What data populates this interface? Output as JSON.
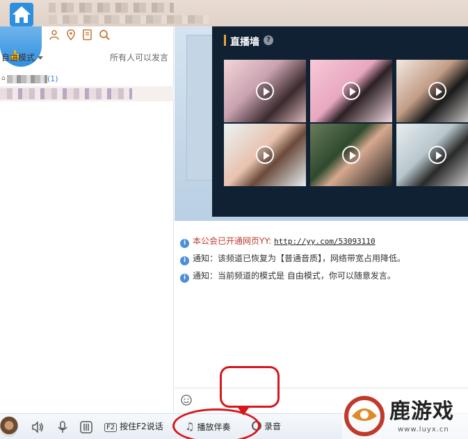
{
  "header": {
    "channel_title": ""
  },
  "left": {
    "mode_label": "自由模式",
    "speak_label": "所有人可以发言",
    "channel_count": "(1)"
  },
  "live_wall": {
    "title": "直播墙",
    "help": "?"
  },
  "chat": {
    "messages": [
      {
        "text": "本公会已开通网页YY:",
        "link": "http://yy.com/53093110"
      },
      {
        "text": "通知：该频道已恢复为【普通音质】，网络带宽占用降低。"
      },
      {
        "text": "通知：当前频道的模式是 自由模式，你可以随意发言。"
      }
    ]
  },
  "toolbar": {
    "f2_key": "F2",
    "push_to_talk": "按住F2说话",
    "play_accompaniment": "播放伴奏",
    "record": "录音"
  },
  "watermark": {
    "text": "鹿游戏",
    "url": "www.luyx.cn"
  },
  "colors": {
    "accent_blue": "#2f8fdf",
    "wall_bg": "#0f2133",
    "annotation_red": "#d7161b"
  }
}
